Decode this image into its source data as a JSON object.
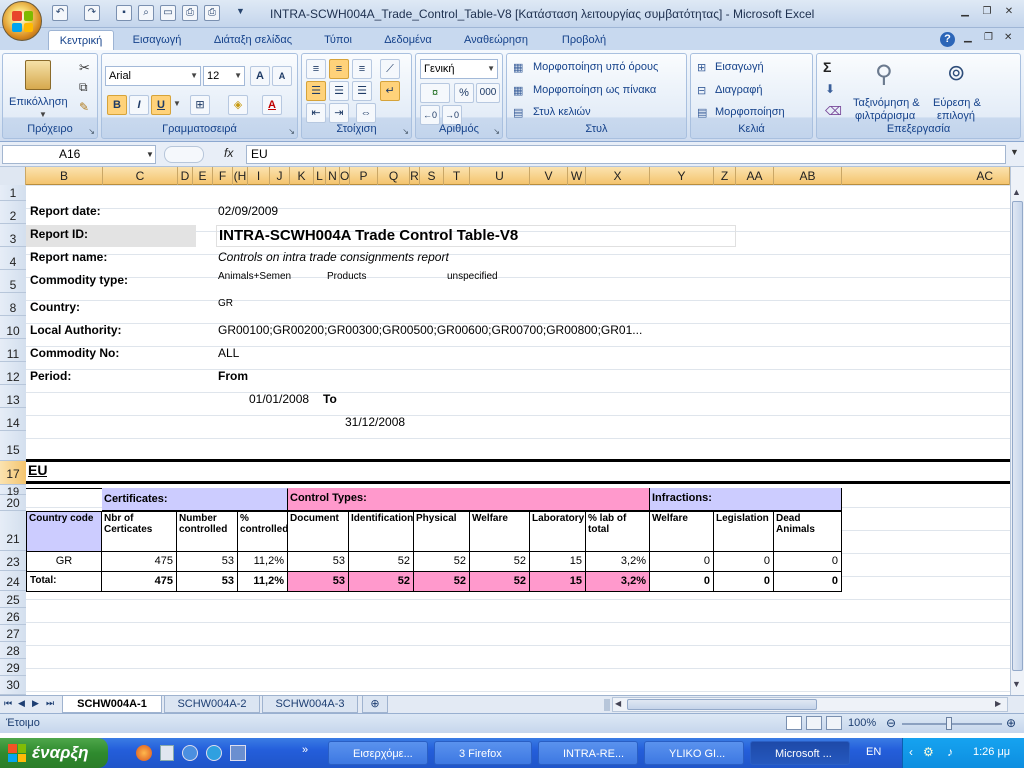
{
  "window": {
    "title": "INTRA-SCWH004A_Trade_Control_Table-V8  [Κατάσταση λειτουργίας συμβατότητας] - Microsoft Excel"
  },
  "tabs": [
    "Κεντρική",
    "Εισαγωγή",
    "Διάταξη σελίδας",
    "Τύποι",
    "Δεδομένα",
    "Αναθεώρηση",
    "Προβολή"
  ],
  "ribbon": {
    "clipboard": {
      "label": "Πρόχειρο",
      "paste": "Επικόλληση"
    },
    "font": {
      "label": "Γραμματοσειρά",
      "name": "Arial",
      "size": "12",
      "bold": "B",
      "italic": "I",
      "underline": "U"
    },
    "alignment": {
      "label": "Στοίχιση"
    },
    "number": {
      "label": "Αριθμός",
      "format": "Γενική",
      "percent": "%",
      "thousands": "000"
    },
    "styles": {
      "label": "Στυλ",
      "conditional": "Μορφοποίηση υπό όρους",
      "as_table": "Μορφοποίηση ως πίνακα",
      "cell_styles": "Στυλ κελιών"
    },
    "cells": {
      "label": "Κελιά",
      "insert": "Εισαγωγή",
      "delete": "Διαγραφή",
      "format": "Μορφοποίηση"
    },
    "editing": {
      "label": "Επεξεργασία",
      "sort1": "Ταξινόμηση &",
      "sort2": "φιλτράρισμα",
      "find1": "Εύρεση &",
      "find2": "επιλογή"
    }
  },
  "formula_bar": {
    "name_box": "A16",
    "fx": "fx",
    "value": "EU"
  },
  "columns": [
    "B",
    "C",
    "D",
    "E",
    "F",
    "G",
    "H",
    "I",
    "J",
    "K",
    "L",
    "M",
    "N",
    "O",
    "P",
    "Q",
    "R",
    "S",
    "T",
    "U",
    "V",
    "W",
    "X",
    "Y",
    "Z",
    "AA",
    "AB",
    "AC"
  ],
  "column_labels": [
    "B",
    "C",
    "D",
    "E",
    "F",
    "(H",
    "I",
    "J",
    "K",
    "L",
    "N",
    "O",
    "P",
    "Q",
    "R",
    "S",
    "T",
    "U",
    "V",
    "W",
    "X",
    "Y",
    "Z",
    "AA",
    "AB",
    "AC"
  ],
  "rows": [
    "1",
    "2",
    "3",
    "4",
    "5",
    "8",
    "10",
    "11",
    "12",
    "13",
    "14",
    "15",
    "17",
    "19",
    "20",
    "21",
    "23",
    "24",
    "25",
    "26",
    "27",
    "28",
    "29",
    "30"
  ],
  "report": {
    "date_label": "Report date:",
    "date": "02/09/2009",
    "id_label": "Report ID:",
    "id": "INTRA-SCWH004A Trade Control Table-V8",
    "name_label": "Report name:",
    "name": "Controls on intra trade consignments report",
    "commodity_type_label": "Commodity type:",
    "commodity_types": [
      "Animals+Semen",
      "Products",
      "unspecified"
    ],
    "country_label": "Country:",
    "country": "GR",
    "local_authority_label": "Local Authority:",
    "local_authority": "GR00100;GR00200;GR00300;GR00500;GR00600;GR00700;GR00800;GR01...",
    "commodity_no_label": "Commodity No:",
    "commodity_no": "ALL",
    "period_label": "Period:",
    "from_label": "From",
    "from_date": "01/01/2008",
    "to_label": "To",
    "to_date": "31/12/2008",
    "section": "EU"
  },
  "table": {
    "group_certificates": "Certificates:",
    "group_controls": "Control Types:",
    "group_infractions": "Infractions:",
    "headers": [
      "Country code",
      "Nbr of Certicates",
      "Number controlled",
      "% controlled",
      "Document",
      "Identification",
      "Physical",
      "Welfare",
      "Laboratory",
      "% lab of total",
      "Welfare",
      "Legislation",
      "Dead Animals"
    ],
    "row_gr": [
      "GR",
      "475",
      "53",
      "11,2%",
      "53",
      "52",
      "52",
      "52",
      "15",
      "3,2%",
      "0",
      "0",
      "0"
    ],
    "row_total": [
      "Total:",
      "475",
      "53",
      "11,2%",
      "53",
      "52",
      "52",
      "52",
      "15",
      "3,2%",
      "0",
      "0",
      "0"
    ]
  },
  "sheets": [
    "SCHW004A-1",
    "SCHW004A-2",
    "SCHW004A-3"
  ],
  "status": {
    "ready": "Έτοιμο",
    "zoom": "100%"
  },
  "taskbar": {
    "start": "έναρξη",
    "items": [
      "Εισερχόμε...",
      "3 Firefox",
      "INTRA-RE...",
      "YLIKO GI...",
      "Microsoft ..."
    ],
    "lang": "EN",
    "time": "1:26 μμ"
  },
  "colors": {
    "lavender": "#ccccff",
    "pink": "#ff99cc",
    "selected_header": "#f4c46e"
  }
}
